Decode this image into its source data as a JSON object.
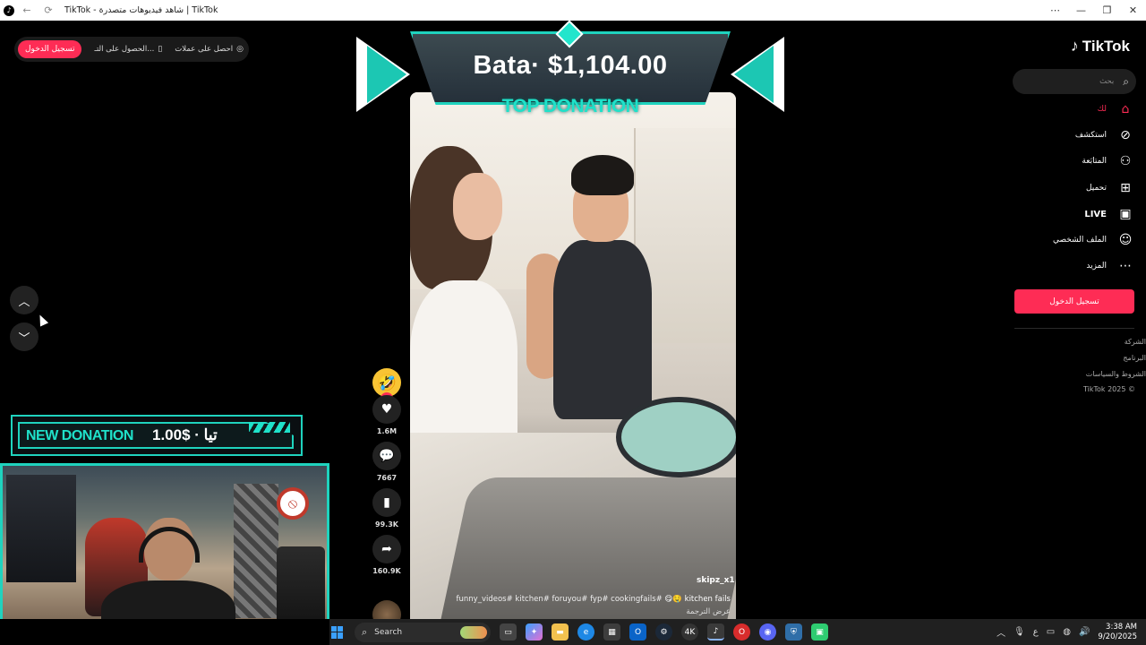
{
  "window": {
    "title": "TikTok - شاهد فيديوهات متصدرة | TikTok",
    "controls": [
      "⋯",
      "—",
      "❐",
      "✕"
    ]
  },
  "header": {
    "login_pill": "تسجيل الدخول",
    "get_app_label": "الحصول على التـ...",
    "get_coins_label": "احصل على عملات"
  },
  "overlay": {
    "top_donation_amount": "Bata· $1,104.00",
    "top_donation_label": "TOP DONATION",
    "new_donation_label": "NEW DONATION",
    "new_donation_value": "1.00$ · تيا"
  },
  "video": {
    "handle": "skipz_x1",
    "caption_title": "kitchen fails",
    "caption_emojis": "😋🤤",
    "hashtags": "funny_videos# kitchen# foruyou# fyp# cookingfails#",
    "translate": "عرض الترجمة",
    "progress": 0.48
  },
  "actions": {
    "likes": "1.6M",
    "comments": "7667",
    "saves": "99.3K",
    "shares": "160.9K"
  },
  "sidebar": {
    "logo": "TikTok",
    "search_placeholder": "بحث",
    "items": [
      {
        "label": "لك",
        "icon": "home-icon",
        "active": true
      },
      {
        "label": "استكشف",
        "icon": "compass-icon"
      },
      {
        "label": "المتابَعة",
        "icon": "user-follow-icon"
      },
      {
        "label": "تحميل",
        "icon": "upload-icon"
      },
      {
        "label": "LIVE",
        "icon": "live-icon"
      },
      {
        "label": "الملف الشخصي",
        "icon": "profile-icon"
      },
      {
        "label": "المزيد",
        "icon": "more-icon"
      }
    ],
    "login_button": "تسجيل الدخول",
    "footer": [
      "الشركة",
      "البرنامج",
      "الشروط والسياسات",
      "TikTok 2025 ©"
    ]
  },
  "taskbar": {
    "search_placeholder": "Search",
    "language": "ع",
    "time": "3:38 AM",
    "date": "9/20/2025"
  },
  "colors": {
    "brand": "#fe2c55",
    "overlay_accent": "#1fe1c9"
  }
}
